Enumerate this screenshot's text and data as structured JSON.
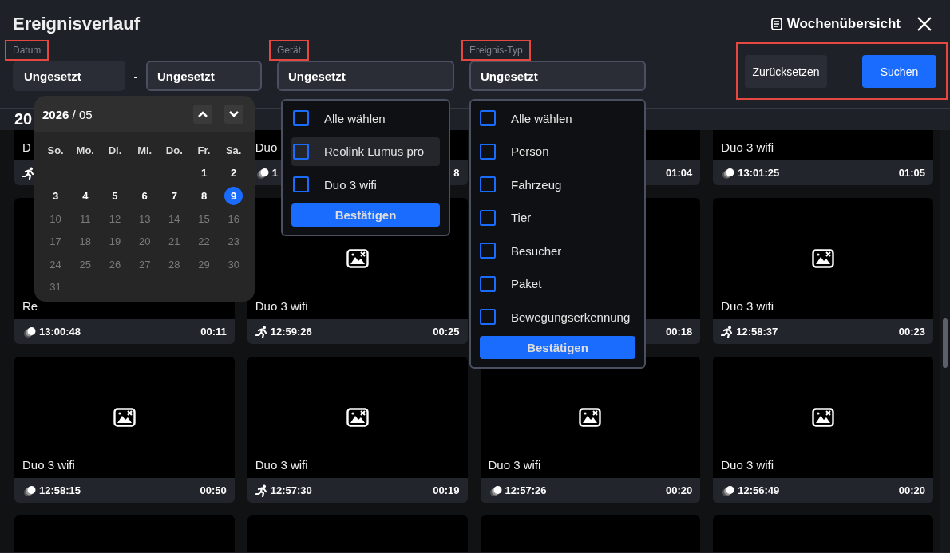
{
  "header": {
    "title": "Ereignisverlauf",
    "week_view": "Wochenübersicht"
  },
  "filters": {
    "date": {
      "label": "Datum",
      "highlighted": true,
      "from": "Ungesetzt",
      "separator": "-",
      "to": "Ungesetzt"
    },
    "device": {
      "label": "Gerät",
      "highlighted": true,
      "value": "Ungesetzt"
    },
    "event_type": {
      "label": "Ereignis-Typ",
      "highlighted": true,
      "value": "Ungesetzt"
    }
  },
  "actions": {
    "highlighted": true,
    "buttons": [
      {
        "label": "Zurücksetzen",
        "kind": "secondary"
      },
      {
        "label": "Suchen",
        "kind": "primary"
      }
    ]
  },
  "date_heading": "20",
  "cards": [
    {
      "title": "D",
      "kind": "person"
    },
    {
      "title": "Duo",
      "kind": "motion",
      "time": "1",
      "duration": "8"
    },
    {
      "duration": "01:04"
    },
    {
      "title": "Duo 3 wifi",
      "kind": "motion",
      "time": "13:01:25",
      "duration": "01:05"
    },
    {
      "title": "Re",
      "kind": "motion",
      "time": "13:00:48",
      "duration": "00:11"
    },
    {
      "title": "Duo 3 wifi",
      "kind": "person",
      "time": "12:59:26",
      "duration": "00:25",
      "image_missing": true
    },
    {
      "duration": "00:18"
    },
    {
      "title": "Duo 3 wifi",
      "kind": "person",
      "time": "12:58:37",
      "duration": "00:23",
      "image_missing": true
    },
    {
      "title": "Duo 3 wifi",
      "kind": "motion",
      "time": "12:58:15",
      "duration": "00:50",
      "image_missing": true
    },
    {
      "title": "Duo 3 wifi",
      "kind": "person",
      "time": "12:57:30",
      "duration": "00:19",
      "image_missing": true
    },
    {
      "title": "Duo 3 wifi",
      "kind": "motion",
      "time": "12:57:26",
      "duration": "00:20",
      "image_missing": true
    },
    {
      "title": "Duo 3 wifi",
      "kind": "motion",
      "time": "12:56:49",
      "duration": "00:20",
      "image_missing": true
    }
  ],
  "calendar": {
    "heading": "**2026** / 05",
    "weekdays": [
      "So.",
      "Mo.",
      "Di.",
      "Mi.",
      "Do.",
      "Fr.",
      "Sa."
    ],
    "weeks": [
      {
        "days": [
          {
            "label": "1",
            "disabled": false,
            "selected": false
          },
          {
            "label": "2",
            "disabled": false,
            "selected": false
          }
        ]
      },
      {
        "days": [
          {
            "label": "3",
            "disabled": false,
            "selected": false
          },
          {
            "label": "4",
            "disabled": false,
            "selected": false
          },
          {
            "label": "5",
            "disabled": false,
            "selected": false
          },
          {
            "label": "6",
            "disabled": false,
            "selected": false
          },
          {
            "label": "7",
            "disabled": false,
            "selected": false
          },
          {
            "label": "8",
            "disabled": false,
            "selected": false
          },
          {
            "label": "9",
            "disabled": false,
            "selected": true
          }
        ]
      },
      {
        "days": [
          {
            "label": "10",
            "disabled": true,
            "selected": false
          },
          {
            "label": "11",
            "disabled": true,
            "selected": false
          },
          {
            "label": "12",
            "disabled": true,
            "selected": false
          },
          {
            "label": "13",
            "disabled": true,
            "selected": false
          },
          {
            "label": "14",
            "disabled": true,
            "selected": false
          },
          {
            "label": "15",
            "disabled": true,
            "selected": false
          },
          {
            "label": "16",
            "disabled": true,
            "selected": false
          }
        ]
      },
      {
        "days": [
          {
            "label": "17",
            "disabled": true,
            "selected": false
          },
          {
            "label": "18",
            "disabled": true,
            "selected": false
          },
          {
            "label": "19",
            "disabled": true,
            "selected": false
          },
          {
            "label": "20",
            "disabled": true,
            "selected": false
          },
          {
            "label": "21",
            "disabled": true,
            "selected": false
          },
          {
            "label": "22",
            "disabled": true,
            "selected": false
          },
          {
            "label": "23",
            "disabled": true,
            "selected": false
          }
        ]
      },
      {
        "days": [
          {
            "label": "24",
            "disabled": true,
            "selected": false
          },
          {
            "label": "25",
            "disabled": true,
            "selected": false
          },
          {
            "label": "26",
            "disabled": true,
            "selected": false
          },
          {
            "label": "27",
            "disabled": true,
            "selected": false
          },
          {
            "label": "28",
            "disabled": true,
            "selected": false
          },
          {
            "label": "29",
            "disabled": true,
            "selected": false
          },
          {
            "label": "30",
            "disabled": true,
            "selected": false
          }
        ]
      },
      {
        "days": [
          {
            "label": "31",
            "disabled": true,
            "selected": false
          }
        ]
      }
    ]
  },
  "device_menu": {
    "items": [
      {
        "label": "Alle wählen",
        "checked": false,
        "highlighted": false
      },
      {
        "label": "Reolink Lumus pro",
        "checked": false,
        "highlighted": true
      },
      {
        "label": "Duo 3 wifi",
        "checked": false,
        "highlighted": false
      }
    ],
    "confirm": "Bestätigen"
  },
  "event_menu": {
    "items": [
      {
        "label": "Alle wählen",
        "checked": false,
        "highlighted": false
      },
      {
        "label": "Person",
        "checked": false,
        "highlighted": false
      },
      {
        "label": "Fahrzeug",
        "checked": false,
        "highlighted": false
      },
      {
        "label": "Tier",
        "checked": false,
        "highlighted": false
      },
      {
        "label": "Besucher",
        "checked": false,
        "highlighted": false
      },
      {
        "label": "Paket",
        "checked": false,
        "highlighted": false
      },
      {
        "label": "Bewegungserkennung",
        "checked": false,
        "highlighted": false
      }
    ],
    "confirm": "Bestätigen"
  }
}
